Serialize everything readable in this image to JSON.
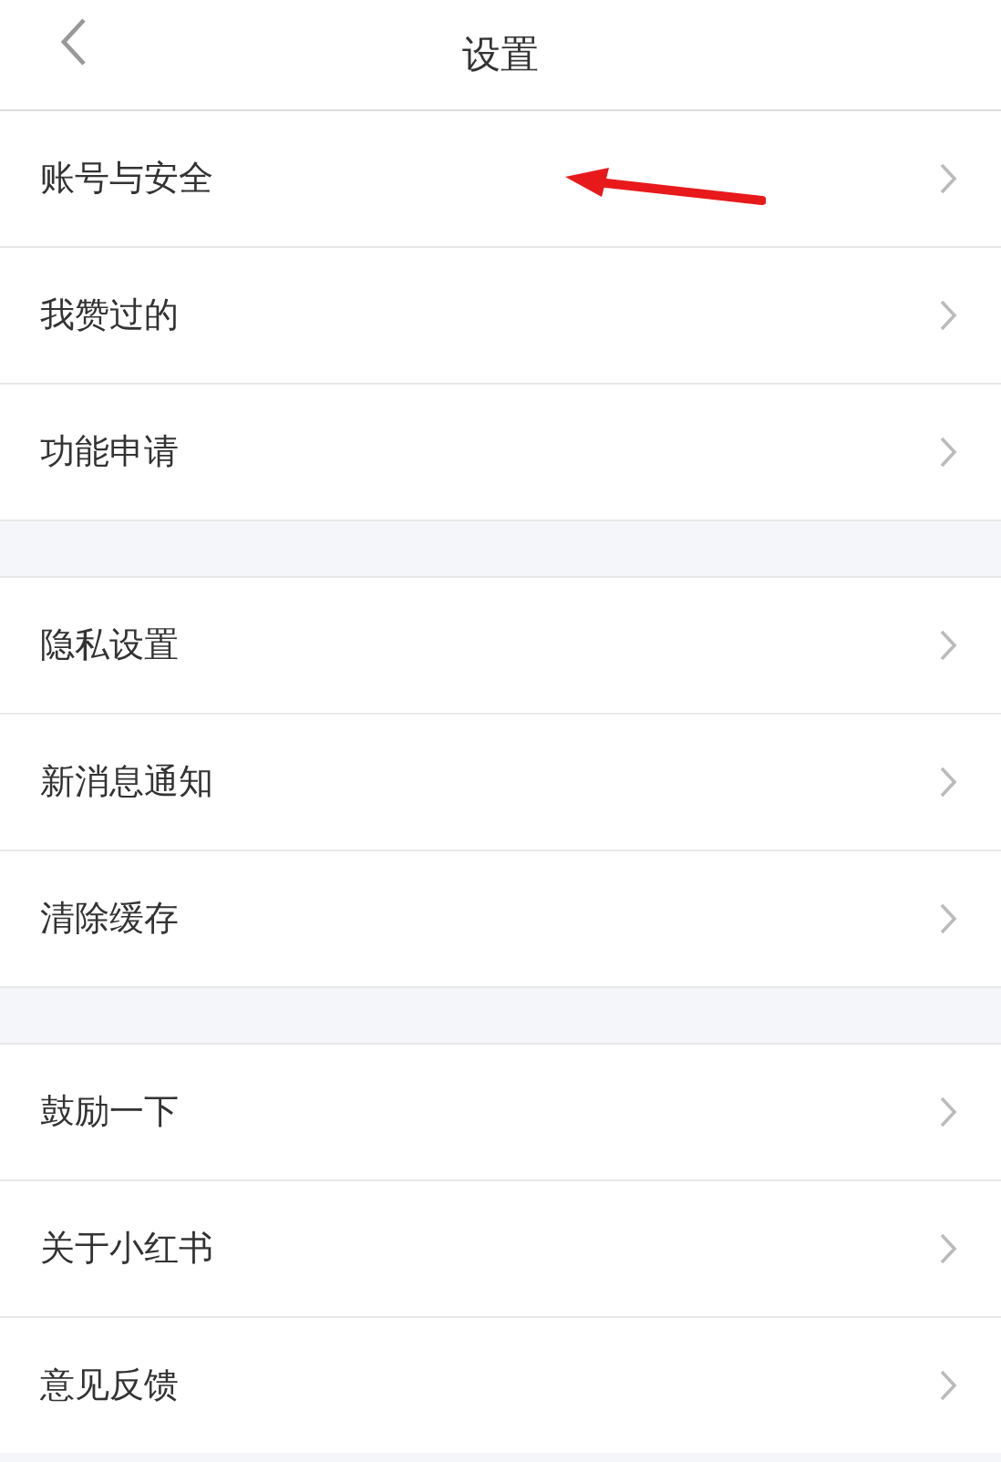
{
  "header": {
    "title": "设置"
  },
  "groups": [
    {
      "items": [
        {
          "label": "账号与安全"
        },
        {
          "label": "我赞过的"
        },
        {
          "label": "功能申请"
        }
      ]
    },
    {
      "items": [
        {
          "label": "隐私设置"
        },
        {
          "label": "新消息通知"
        },
        {
          "label": "清除缓存"
        }
      ]
    },
    {
      "items": [
        {
          "label": "鼓励一下"
        },
        {
          "label": "关于小红书"
        },
        {
          "label": "意见反馈"
        }
      ]
    }
  ]
}
